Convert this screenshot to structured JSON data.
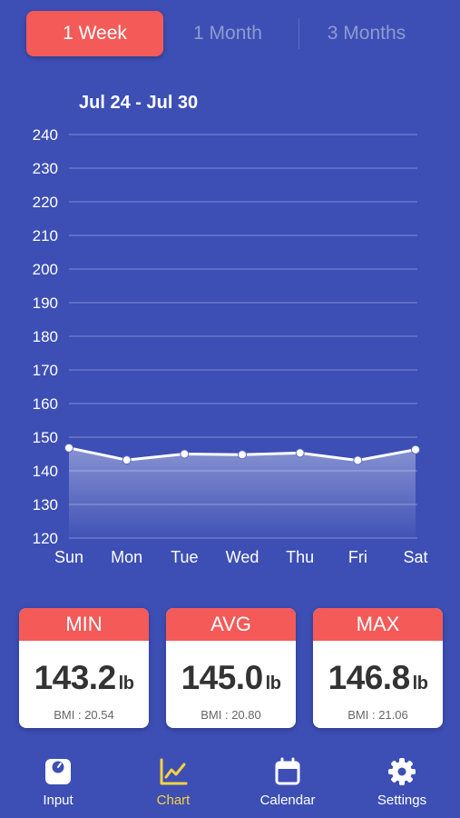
{
  "tabs": [
    {
      "label": "1 Week",
      "active": true
    },
    {
      "label": "1 Month",
      "active": false
    },
    {
      "label": "3 Months",
      "active": false
    }
  ],
  "date_range": "Jul 24 - Jul 30",
  "chart_data": {
    "type": "area",
    "categories": [
      "Sun",
      "Mon",
      "Tue",
      "Wed",
      "Thu",
      "Fri",
      "Sat"
    ],
    "series": [
      {
        "values": [
          146.8,
          143.2,
          145.0,
          144.8,
          145.3,
          143.1,
          146.3
        ]
      }
    ],
    "ylim": [
      120,
      240
    ],
    "yticks": [
      120,
      130,
      140,
      150,
      160,
      170,
      180,
      190,
      200,
      210,
      220,
      230,
      240
    ],
    "grid": true,
    "line_color": "#ffffff",
    "grid_color": "#7f8bd0"
  },
  "stats": {
    "min": {
      "label": "MIN",
      "value": "143.2",
      "unit": "lb",
      "bmi": "BMI : 20.54"
    },
    "avg": {
      "label": "AVG",
      "value": "145.0",
      "unit": "lb",
      "bmi": "BMI : 20.80"
    },
    "max": {
      "label": "MAX",
      "value": "146.8",
      "unit": "lb",
      "bmi": "BMI : 21.06"
    }
  },
  "nav": {
    "input": {
      "label": "Input",
      "icon": "scale-icon"
    },
    "chart": {
      "label": "Chart",
      "icon": "chart-icon",
      "active": true
    },
    "calendar": {
      "label": "Calendar",
      "icon": "calendar-icon"
    },
    "settings": {
      "label": "Settings",
      "icon": "gear-icon"
    }
  },
  "colors": {
    "background": "#3d4fb5",
    "accent": "#f35a58",
    "active_nav": "#f7d23e"
  }
}
